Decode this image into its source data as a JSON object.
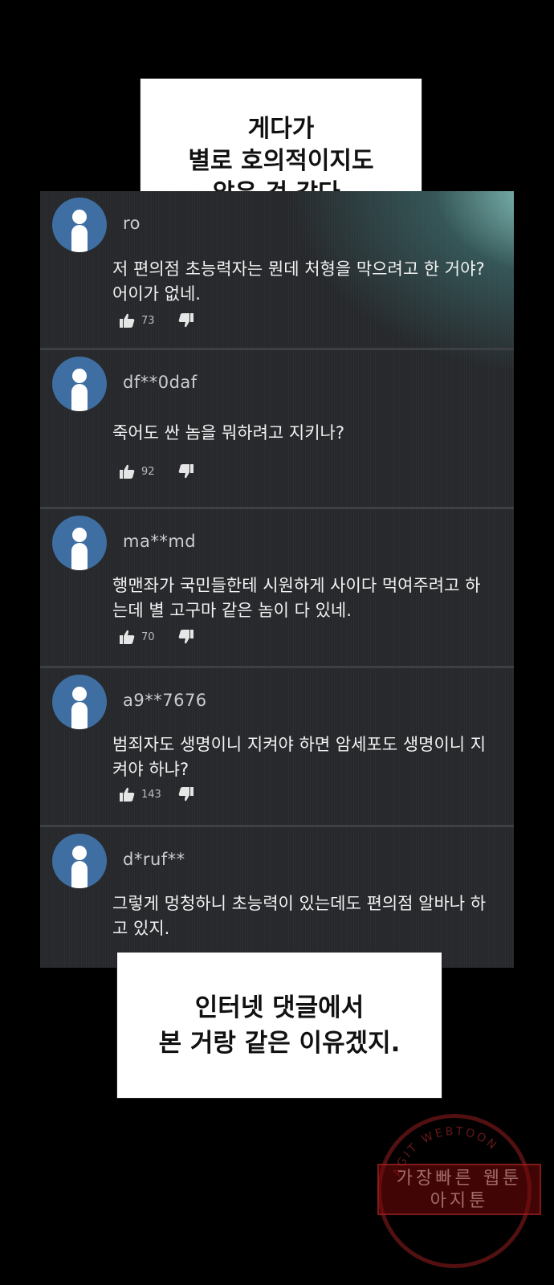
{
  "caption_top": {
    "lines": [
      "게다가",
      "별로 호의적이지도",
      "않은 것 같다."
    ]
  },
  "caption_bottom": {
    "lines": [
      "인터넷 댓글에서",
      "본 거랑 같은 이유겠지."
    ]
  },
  "comments": [
    {
      "user": "ro",
      "text": "저 편의점 초능력자는 뭔데 처형을 막으려고 한 거야? 어이가 없네.",
      "likes": "73"
    },
    {
      "user": "df**0daf",
      "text": "죽어도 싼 놈을 뭐하려고 지키나?",
      "likes": "92"
    },
    {
      "user": "ma**md",
      "text": "행맨좌가 국민들한테 시원하게 사이다 먹여주려고 하는데 별 고구마 같은 놈이 다 있네.",
      "likes": "70"
    },
    {
      "user": "a9**7676",
      "text": "범죄자도 생명이니 지켜야 하면 암세포도 생명이니 지켜야 하냐?",
      "likes": "143"
    },
    {
      "user": "d*ruf**",
      "text": "그렇게 멍청하니 초능력이 있는데도 편의점 알바나 하고 있지.",
      "likes": ""
    }
  ],
  "icons": {
    "avatar": "user-avatar-icon",
    "like": "thumbs-up-icon",
    "dislike": "thumbs-down-icon"
  },
  "watermark": {
    "ring_text": "AGIT WEBTOON",
    "band_line1": "가장빠른 웹툰",
    "band_line2": "아지툰"
  },
  "colors": {
    "background": "#000000",
    "panel": "#26282b",
    "avatar": "#3f6fa2",
    "stamp": "#8a1414"
  }
}
